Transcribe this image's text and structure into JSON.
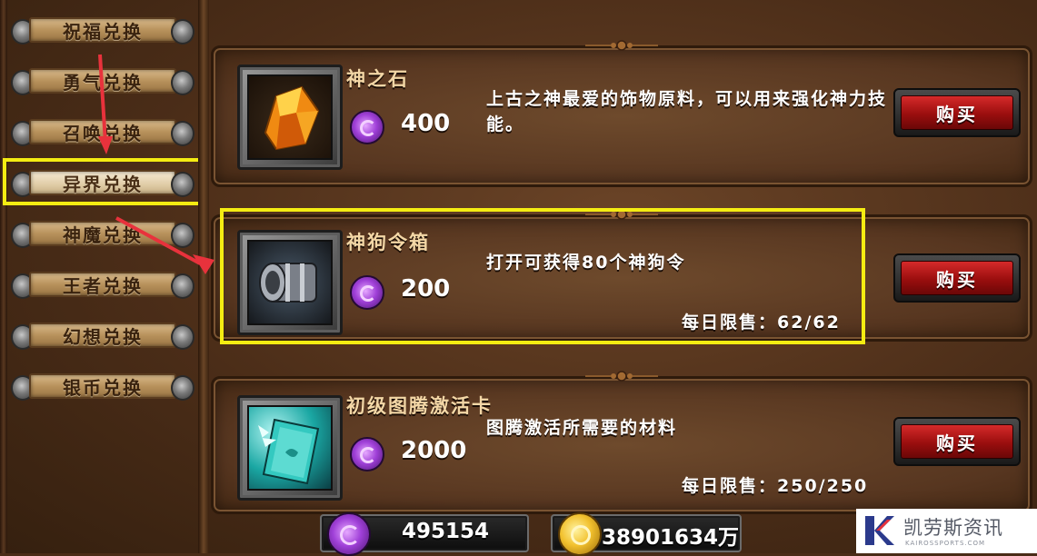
{
  "sidebar": {
    "tabs": [
      {
        "label": "祝福兑换",
        "active": false
      },
      {
        "label": "勇气兑换",
        "active": false
      },
      {
        "label": "召唤兑换",
        "active": false
      },
      {
        "label": "异界兑换",
        "active": true
      },
      {
        "label": "神魔兑换",
        "active": false
      },
      {
        "label": "王者兑换",
        "active": false
      },
      {
        "label": "幻想兑换",
        "active": false
      },
      {
        "label": "银币兑换",
        "active": false
      }
    ]
  },
  "items": [
    {
      "name": "神之石",
      "icon": "orange-gem-icon",
      "price": "400",
      "description": "上古之神最爱的饰物原料，可以用来强化神力技能。",
      "limit": "",
      "buy_label": "购买"
    },
    {
      "name": "神狗令箱",
      "icon": "chest-icon",
      "price": "200",
      "description": "打开可获得80个神狗令",
      "limit": "每日限售：62/62",
      "buy_label": "购买"
    },
    {
      "name": "初级图腾激活卡",
      "icon": "activation-card-icon",
      "price": "2000",
      "description": "图腾激活所需要的材料",
      "limit": "每日限售：250/250",
      "buy_label": "购买"
    }
  ],
  "currency": {
    "soul": {
      "icon": "purple-soul-icon",
      "value": "495154"
    },
    "gold": {
      "icon": "gold-coin-icon",
      "value": "38901634万"
    }
  },
  "watermark": {
    "title": "凯劳斯资讯",
    "subtitle": "KAIROSSPORTS.COM"
  },
  "colors": {
    "highlight": "#f4ec12",
    "arrow": "#e8323c",
    "buy_button": "#b81717",
    "currency_purple": "#a040d8"
  }
}
